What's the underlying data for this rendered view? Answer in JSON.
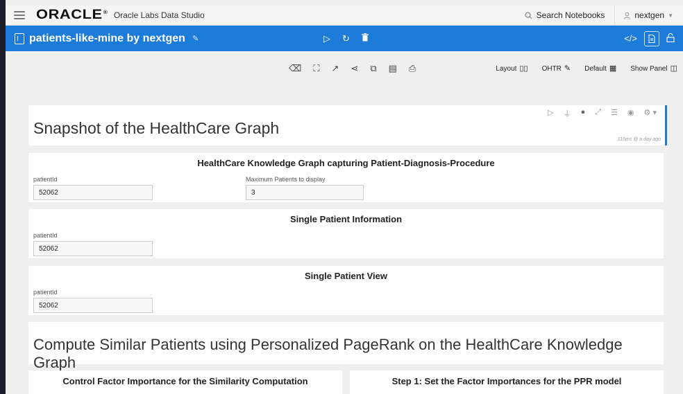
{
  "topnav": {
    "logo": "ORACLE",
    "app_name": "Oracle Labs Data Studio",
    "search_label": "Search Notebooks",
    "user": "nextgen"
  },
  "notebook": {
    "title": "patients-like-mine by nextgen"
  },
  "toolbar": {
    "layout_label": "Layout",
    "ohtr_label": "OHTR",
    "default_label": "Default",
    "show_panel_label": "Show Panel"
  },
  "paragraphs": {
    "snapshot": {
      "title": "Snapshot of the HealthCare Graph",
      "meta": "115ms @ a day ago"
    },
    "kg_form": {
      "title": "HealthCare Knowledge Graph capturing Patient-Diagnosis-Procedure",
      "field1_label": "patientId",
      "field1_value": "52062",
      "field2_label": "Maximum Patients to display",
      "field2_value": "3"
    },
    "single_info": {
      "title": "Single Patient Information",
      "field_label": "patientId",
      "field_value": "52062"
    },
    "single_view": {
      "title": "Single Patient View",
      "field_label": "patientId",
      "field_value": "52062"
    },
    "compute": {
      "title": "Compute Similar Patients using Personalized PageRank on the HealthCare Knowledge Graph"
    },
    "control_factor": {
      "title": "Control Factor Importance for the Similarity Computation"
    },
    "step1": {
      "title": "Step 1: Set the Factor Importances for the PPR model"
    }
  },
  "colors": {
    "accent_blue": "#1c7bd8",
    "edge_dark": "#1c1e2a",
    "page_bg": "#efefef"
  }
}
